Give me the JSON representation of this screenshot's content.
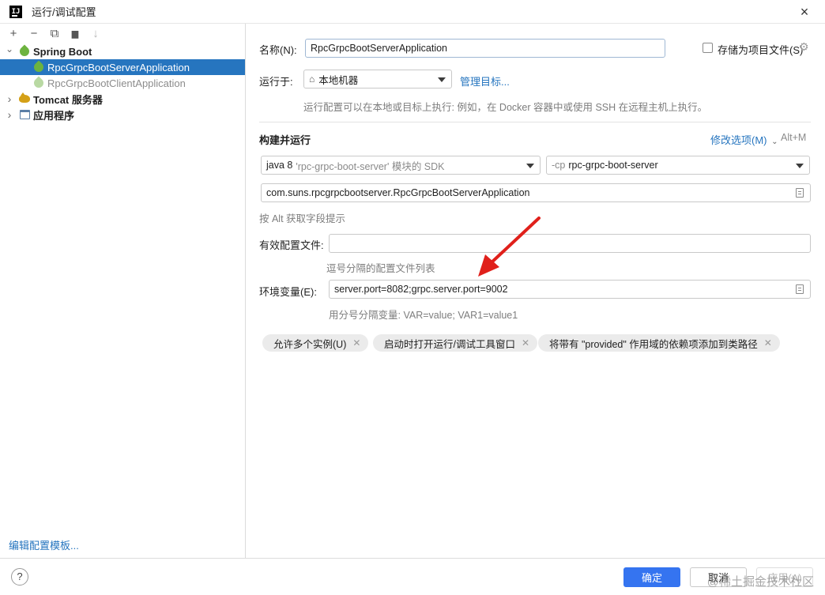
{
  "window": {
    "title": "运行/调试配置",
    "close_icon": "×"
  },
  "toolbar": {
    "add": "+",
    "remove": "−",
    "copy": "⧉",
    "folder": "▆",
    "sort": "↓"
  },
  "tree": {
    "spring_boot": "Spring Boot",
    "server_app": "RpcGrpcBootServerApplication",
    "client_app": "RpcGrpcBootClientApplication",
    "tomcat": "Tomcat 服务器",
    "application": "应用程序",
    "expanded_chevron": "⌄",
    "collapsed_chevron": "›"
  },
  "edit_templates": "编辑配置模板...",
  "form": {
    "name_label": "名称(N):",
    "name_value": "RpcGrpcBootServerApplication",
    "store_as_project_file": "存储为项目文件(S)",
    "run_on_label": "运行于:",
    "run_on_value": "本地机器",
    "manage_targets": "管理目标...",
    "run_on_hint": "运行配置可以在本地或目标上执行: 例如，在 Docker 容器中或使用 SSH 在远程主机上执行。",
    "build_and_run": "构建并运行",
    "modify_options": "修改选项(M)",
    "modify_shortcut": "Alt+M",
    "jdk_prefix": "java 8",
    "jdk_suffix": "'rpc-grpc-boot-server' 模块的 SDK",
    "cp_prefix": "-cp",
    "cp_module": "rpc-grpc-boot-server",
    "main_class": "com.suns.rpcgrpcbootserver.RpcGrpcBootServerApplication",
    "alt_hint": "按 Alt 获取字段提示",
    "active_profiles_label": "有效配置文件:",
    "active_profiles_value": "",
    "active_profiles_hint": "逗号分隔的配置文件列表",
    "env_label": "环境变量(E):",
    "env_value": "server.port=8082;grpc.server.port=9002",
    "env_hint": "用分号分隔变量: VAR=value; VAR1=value1"
  },
  "chips": [
    {
      "label": "允许多个实例(U)"
    },
    {
      "label": "启动时打开运行/调试工具窗口"
    },
    {
      "label": "将带有 \"provided\" 作用域的依赖项添加到类路径"
    }
  ],
  "buttons": {
    "ok": "确定",
    "cancel": "取消",
    "apply": "应用(A)",
    "help": "?"
  },
  "watermark": "@稀土掘金技术社区",
  "colors": {
    "accent": "#2675bf",
    "primary_button": "#3574f0",
    "annotation_arrow": "#e0201b",
    "spring_green": "#6db33f"
  }
}
